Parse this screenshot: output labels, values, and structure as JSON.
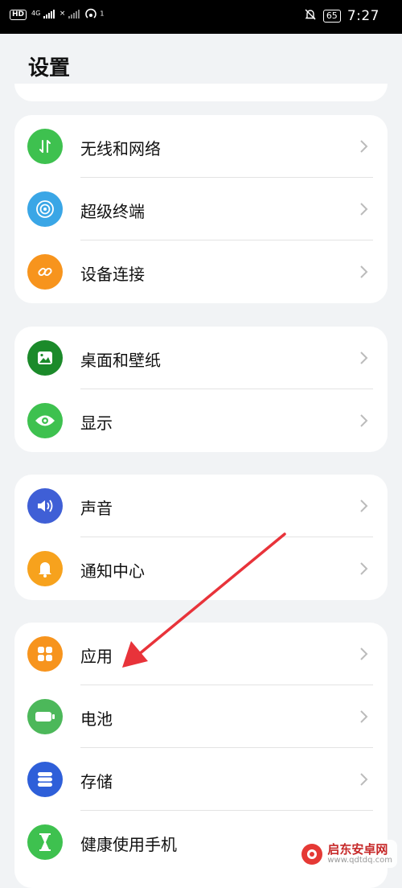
{
  "status_bar": {
    "left_indicators": [
      "HD",
      "4G",
      "×",
      "1"
    ],
    "battery": "65",
    "time": "7:27"
  },
  "page": {
    "title": "设置"
  },
  "groups": [
    {
      "items": [
        {
          "label": "无线和网络",
          "icon": "wifi-network-icon",
          "color": "#3ec14f"
        },
        {
          "label": "超级终端",
          "icon": "super-device-icon",
          "color": "#3aa6e6"
        },
        {
          "label": "设备连接",
          "icon": "link-icon",
          "color": "#f7941d"
        }
      ]
    },
    {
      "items": [
        {
          "label": "桌面和壁纸",
          "icon": "wallpaper-icon",
          "color": "#1b8a2a"
        },
        {
          "label": "显示",
          "icon": "eye-icon",
          "color": "#3ec14f"
        }
      ]
    },
    {
      "items": [
        {
          "label": "声音",
          "icon": "speaker-icon",
          "color": "#3f5fd6"
        },
        {
          "label": "通知中心",
          "icon": "bell-icon",
          "color": "#f7a21d"
        }
      ]
    },
    {
      "items": [
        {
          "label": "应用",
          "icon": "apps-icon",
          "color": "#f7941d"
        },
        {
          "label": "电池",
          "icon": "battery-icon",
          "color": "#4cb85a"
        },
        {
          "label": "存储",
          "icon": "storage-icon",
          "color": "#2e5fd9"
        },
        {
          "label": "健康使用手机",
          "icon": "hourglass-icon",
          "color": "#3ec14f"
        }
      ]
    }
  ],
  "watermark": {
    "name": "启东安卓网",
    "url": "www.qdtdq.com"
  },
  "annotation": {
    "color": "#e8333a"
  }
}
